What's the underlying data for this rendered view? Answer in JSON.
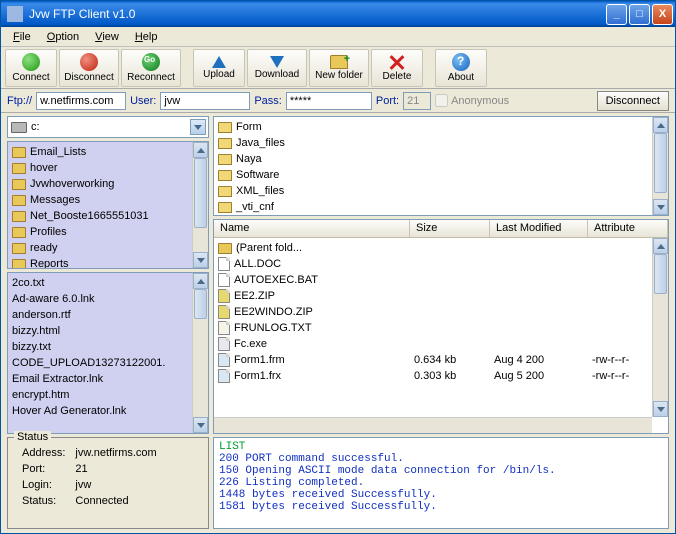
{
  "title": "Jvw FTP Client v1.0",
  "menu": [
    "File",
    "Option",
    "View",
    "Help"
  ],
  "toolbar": [
    {
      "label": "Connect",
      "icon": "green"
    },
    {
      "label": "Disconnect",
      "icon": "red"
    },
    {
      "label": "Reconnect",
      "icon": "go"
    },
    {
      "label": "Upload",
      "icon": "up"
    },
    {
      "label": "Download",
      "icon": "down"
    },
    {
      "label": "New folder",
      "icon": "fold"
    },
    {
      "label": "Delete",
      "icon": "x"
    },
    {
      "label": "About",
      "icon": "about"
    }
  ],
  "conn": {
    "proto_label": "Ftp://",
    "host": "w.netfirms.com",
    "user_label": "User:",
    "user": "jvw",
    "pass_label": "Pass:",
    "pass": "*****",
    "port_label": "Port:",
    "port": "21",
    "anon_label": "Anonymous",
    "disconnect_label": "Disconnect"
  },
  "drive": "c:",
  "local_folders": [
    "Email_Lists",
    "hover",
    "Jvwhoverworking",
    "Messages",
    "Net_Booste1665551031",
    "Profiles",
    "ready",
    "Reports"
  ],
  "local_files": [
    "2co.txt",
    "Ad-aware 6.0.lnk",
    "anderson.rtf",
    "bizzy.html",
    "bizzy.txt",
    "CODE_UPLOAD13273122001.",
    "Email Extractor.lnk",
    "encrypt.htm",
    "Hover Ad Generator.lnk"
  ],
  "remote_folders": [
    "Form",
    "Java_files",
    "Naya",
    "Software",
    "XML_files",
    "_vti_cnf"
  ],
  "remote_list_headers": [
    "Name",
    "Size",
    "Last Modified",
    "Attribute"
  ],
  "remote_files": [
    {
      "name": "(Parent fold...",
      "icon": "fold",
      "size": "",
      "mod": "",
      "attr": ""
    },
    {
      "name": "ALL.DOC",
      "icon": "file",
      "size": "",
      "mod": "",
      "attr": ""
    },
    {
      "name": "AUTOEXEC.BAT",
      "icon": "file",
      "size": "",
      "mod": "",
      "attr": ""
    },
    {
      "name": "EE2.ZIP",
      "icon": "zip",
      "size": "",
      "mod": "",
      "attr": ""
    },
    {
      "name": "EE2WINDO.ZIP",
      "icon": "zip",
      "size": "",
      "mod": "",
      "attr": ""
    },
    {
      "name": "FRUNLOG.TXT",
      "icon": "txt",
      "size": "",
      "mod": "",
      "attr": ""
    },
    {
      "name": "Fc.exe",
      "icon": "exe",
      "size": "",
      "mod": "",
      "attr": ""
    },
    {
      "name": "Form1.frm",
      "icon": "frm",
      "size": "0.634 kb",
      "mod": "Aug 4  200",
      "attr": "-rw-r--r-"
    },
    {
      "name": "Form1.frx",
      "icon": "frm",
      "size": "0.303 kb",
      "mod": "Aug 5  200",
      "attr": "-rw-r--r-"
    }
  ],
  "status": {
    "title": "Status",
    "address_label": "Address:",
    "address": "jvw.netfirms.com",
    "port_label": "Port:",
    "port": "21",
    "login_label": "Login:",
    "login": "jvw",
    "status_label": "Status:",
    "status": "Connected"
  },
  "log": [
    {
      "text": "LIST",
      "cls": "green"
    },
    {
      "text": "200 PORT command successful.",
      "cls": "blue"
    },
    {
      "text": "150 Opening ASCII mode data connection for /bin/ls.",
      "cls": "blue"
    },
    {
      "text": "226 Listing completed.",
      "cls": "blue"
    },
    {
      "text": "1448 bytes received Successfully.",
      "cls": "blue"
    },
    {
      "text": "1581 bytes received Successfully.",
      "cls": "blue"
    }
  ]
}
